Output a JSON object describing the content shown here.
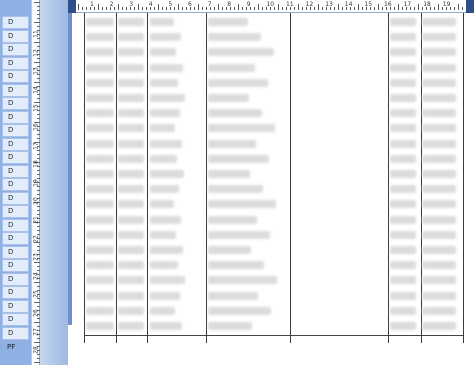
{
  "section_bands": [
    "D",
    "D",
    "D",
    "D",
    "D",
    "D",
    "D",
    "D",
    "D",
    "D",
    "D",
    "D",
    "D",
    "D",
    "D",
    "D",
    "D",
    "D",
    "D",
    "D",
    "D",
    "D",
    "D",
    "D"
  ],
  "footer_band": "PF",
  "vertical_ruler": [
    "11",
    "12",
    "13",
    "14",
    "15",
    "16",
    "17",
    "18",
    "19",
    "20",
    "21",
    "22",
    "23",
    "24",
    "25",
    "26",
    "27",
    "28"
  ],
  "horizontal_ruler": [
    "1",
    "2",
    "3",
    "4",
    "5",
    "6",
    "7",
    "8",
    "9",
    "10",
    "11",
    "12",
    "13",
    "14",
    "15",
    "16",
    "17",
    "18",
    "19"
  ],
  "colors": {
    "band_strip": "#8fb0e3",
    "band_item": "#e3ecfa",
    "ruler_highlight": "#2d4f8a",
    "report_accent": "#6d90cc"
  }
}
